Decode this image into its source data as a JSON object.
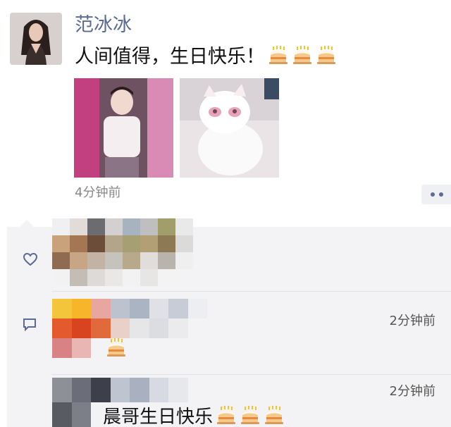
{
  "post": {
    "author": "范冰冰",
    "text": "人间值得，生日快乐！",
    "text_emojis": [
      "birthday-cake",
      "birthday-cake",
      "birthday-cake"
    ],
    "photos": [
      "childhood-photo",
      "white-cat-photo"
    ],
    "time": "4分钟前"
  },
  "comments": [
    {
      "time": "2分钟前",
      "text": "",
      "emojis": [
        "birthday-cake"
      ]
    },
    {
      "time": "2分钟前",
      "text": "晨哥生日快乐",
      "emojis": [
        "birthday-cake",
        "birthday-cake",
        "birthday-cake"
      ]
    }
  ],
  "colors": {
    "name": "#5b6b93",
    "panel": "#f3f3f5",
    "time": "#888888"
  }
}
